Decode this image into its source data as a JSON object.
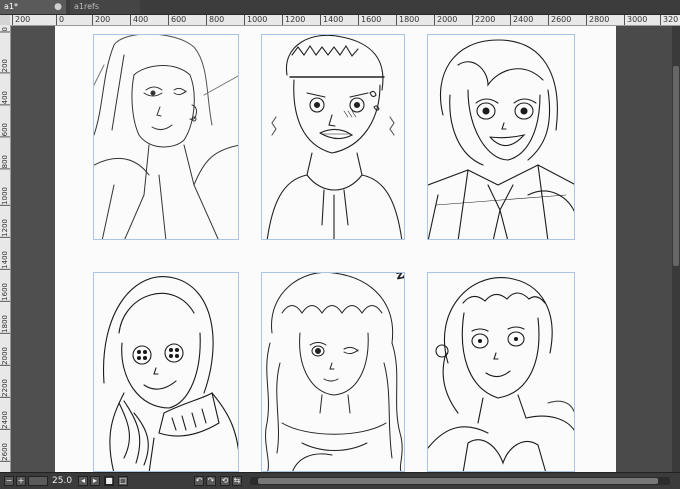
{
  "tabs": [
    {
      "label": "a1*",
      "close": "●",
      "active": true
    },
    {
      "label": "a1refs",
      "close": "✕",
      "active": false
    }
  ],
  "ruler": {
    "h_ticks": [
      "200",
      "0",
      "200",
      "400",
      "600",
      "800",
      "1000",
      "1200",
      "1400",
      "1600",
      "1800",
      "2000",
      "2200",
      "2400",
      "2600",
      "2800",
      "3000",
      "320"
    ],
    "v_ticks": [
      "0",
      "200",
      "400",
      "600",
      "800",
      "1000",
      "1200",
      "1400",
      "1600",
      "1800",
      "2000",
      "2200",
      "2400",
      "2600"
    ]
  },
  "sketch": {
    "zzz": "zzz"
  },
  "status": {
    "zoom": "25.0",
    "buttons": [
      "minus-icon",
      "plus-icon",
      "fit-icon",
      "rotate-left-icon",
      "rotate-right-icon",
      "reset-rotate-icon",
      "flip-icon"
    ]
  }
}
